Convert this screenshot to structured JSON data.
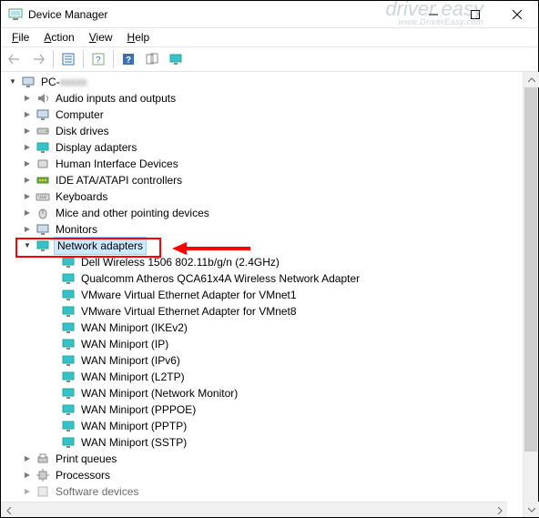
{
  "window": {
    "title": "Device Manager",
    "watermark_main": "driver easy",
    "watermark_sub": "www.DriverEasy.com"
  },
  "menu": {
    "file": "File",
    "action": "Action",
    "view": "View",
    "help": "Help"
  },
  "tree": {
    "root": "PC-",
    "root_blur": "xxxxx",
    "cat_audio": "Audio inputs and outputs",
    "cat_computer": "Computer",
    "cat_disk": "Disk drives",
    "cat_display": "Display adapters",
    "cat_hid": "Human Interface Devices",
    "cat_ide": "IDE ATA/ATAPI controllers",
    "cat_keyboards": "Keyboards",
    "cat_mice": "Mice and other pointing devices",
    "cat_monitors": "Monitors",
    "cat_network": "Network adapters",
    "na_0": "Dell Wireless 1506 802.11b/g/n (2.4GHz)",
    "na_1": "Qualcomm Atheros QCA61x4A Wireless Network Adapter",
    "na_2": "VMware Virtual Ethernet Adapter for VMnet1",
    "na_3": "VMware Virtual Ethernet Adapter for VMnet8",
    "na_4": "WAN Miniport (IKEv2)",
    "na_5": "WAN Miniport (IP)",
    "na_6": "WAN Miniport (IPv6)",
    "na_7": "WAN Miniport (L2TP)",
    "na_8": "WAN Miniport (Network Monitor)",
    "na_9": "WAN Miniport (PPPOE)",
    "na_10": "WAN Miniport (PPTP)",
    "na_11": "WAN Miniport (SSTP)",
    "cat_print": "Print queues",
    "cat_processors": "Processors",
    "cat_software": "Software devices"
  }
}
